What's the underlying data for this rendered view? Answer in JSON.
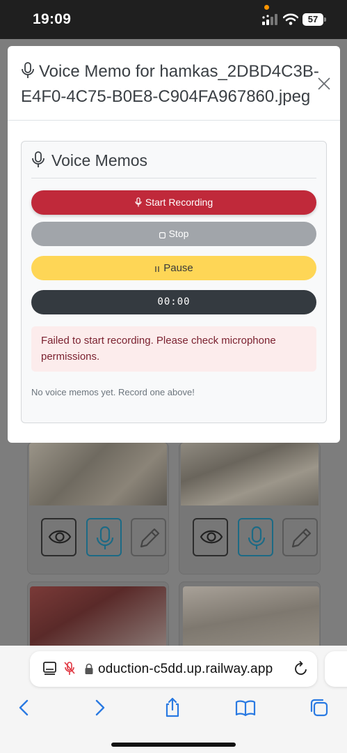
{
  "status_bar": {
    "time": "19:09",
    "battery": "57"
  },
  "modal": {
    "title": "Voice Memo for hamkas_2DBD4C3B-E4F0-4C75-B0E8-C904FA967860.jpeg",
    "panel": {
      "heading": "Voice Memos",
      "record_label": "Start Recording",
      "stop_label": "Stop",
      "pause_label": "Pause",
      "timer": "00:00",
      "error": "Failed to start recording. Please check microphone permissions.",
      "empty_note": "No voice memos yet. Record one above!"
    }
  },
  "browser": {
    "url": "oduction-c5dd.up.railway.app"
  },
  "colors": {
    "record": "#c0293a",
    "stop": "#a1a5aa",
    "pause": "#fed656",
    "timer": "#343a40",
    "alert_bg": "#fcecec",
    "alert_text": "#7b2230",
    "ios_blue": "#2a7ae2"
  },
  "icons": {
    "header": "microphone-icon",
    "close": "close-icon",
    "record": "microphone-icon",
    "stop": "stop-square-icon",
    "pause": "pause-icon",
    "card_view": "eye-icon",
    "card_memo": "microphone-icon",
    "card_edit": "pencil-icon",
    "nav_back": "chevron-left-icon",
    "nav_forward": "chevron-right-icon",
    "share": "share-icon",
    "bookmarks": "book-icon",
    "tabs": "tabs-icon",
    "reload": "reload-icon",
    "lock": "lock-icon",
    "reader": "reader-icon",
    "mic_muted": "mic-muted-icon"
  }
}
